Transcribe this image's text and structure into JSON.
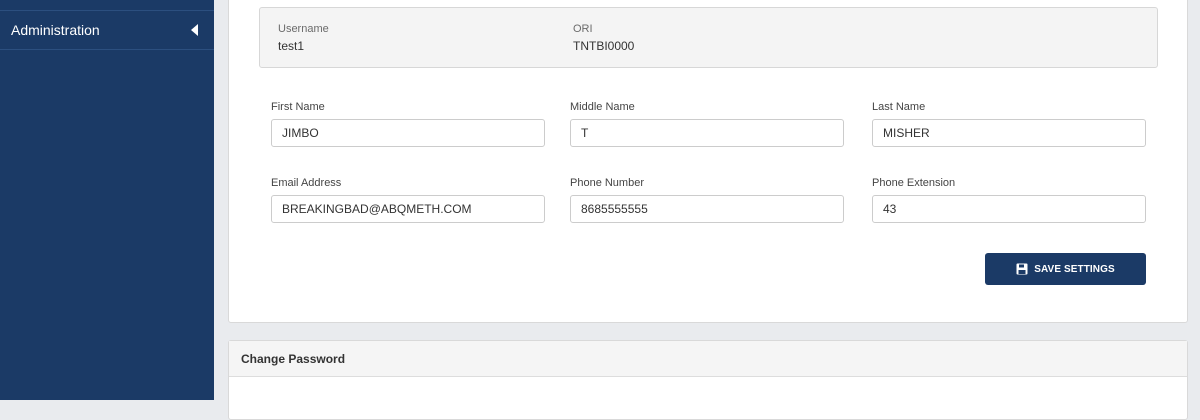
{
  "sidebar": {
    "items": [
      {
        "label": "Administration",
        "icon": "caret-left-icon"
      }
    ]
  },
  "user_info": {
    "username_label": "Username",
    "username_value": "test1",
    "ori_label": "ORI",
    "ori_value": "TNTBI0000"
  },
  "form": {
    "first_name": {
      "label": "First Name",
      "value": "JIMBO"
    },
    "middle_name": {
      "label": "Middle Name",
      "value": "T"
    },
    "last_name": {
      "label": "Last Name",
      "value": "MISHER"
    },
    "email": {
      "label": "Email Address",
      "value": "BREAKINGBAD@ABQMETH.COM"
    },
    "phone": {
      "label": "Phone Number",
      "value": "8685555555"
    },
    "extension": {
      "label": "Phone Extension",
      "value": "43"
    }
  },
  "save_button": {
    "label": "SAVE SETTINGS",
    "icon": "floppy-disk-icon"
  },
  "change_password": {
    "title": "Change Password"
  },
  "colors": {
    "sidebar": "#1b3a66",
    "button": "#1b3a66",
    "background": "#e9ebee"
  }
}
